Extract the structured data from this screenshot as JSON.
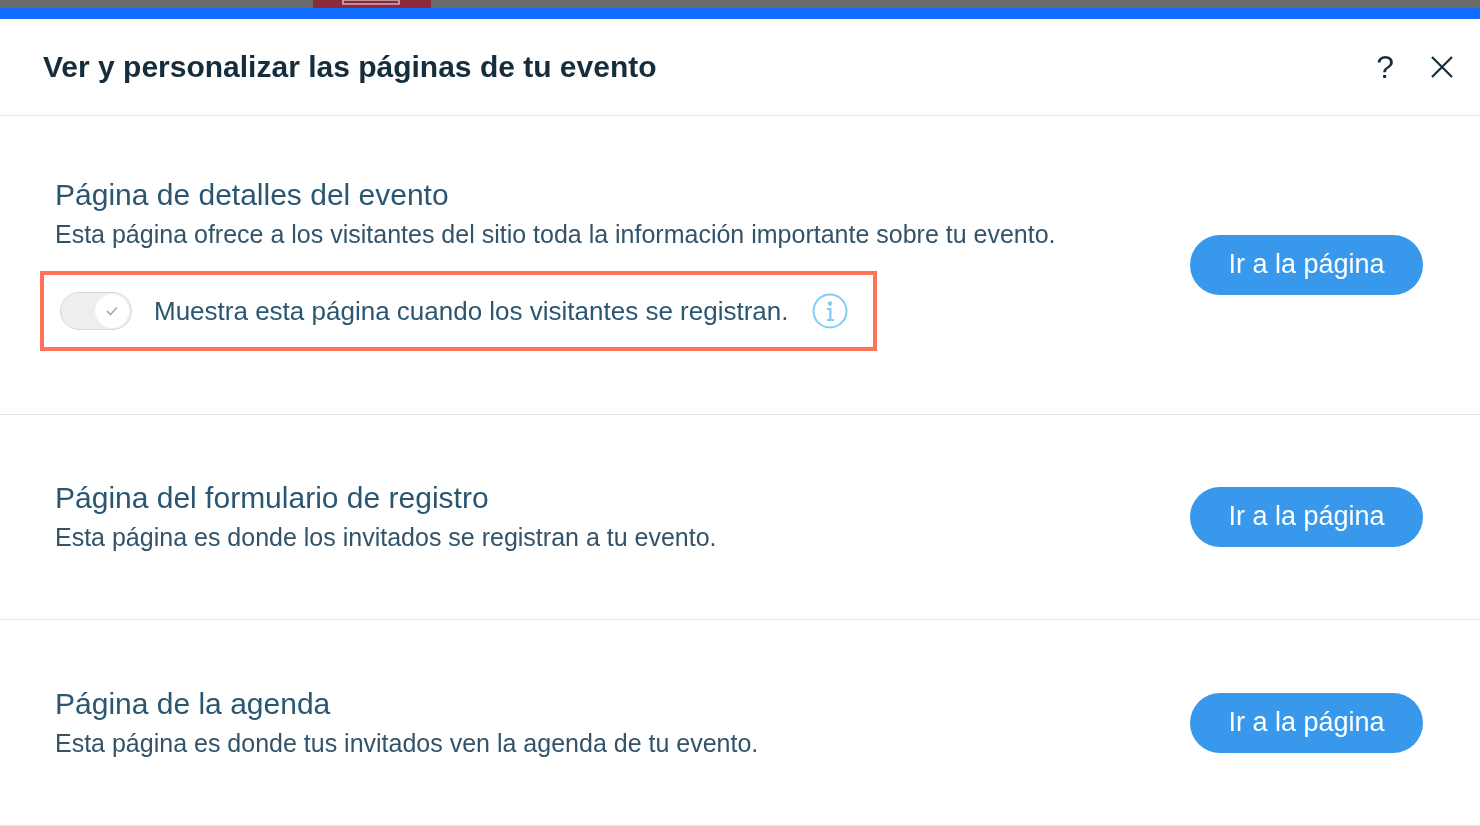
{
  "dialog": {
    "title": "Ver y personalizar las páginas de tu evento",
    "help_label": "?"
  },
  "sections": [
    {
      "heading": "Página de detalles del evento",
      "description": "Esta página ofrece a los visitantes del sitio toda la información importante sobre tu evento.",
      "button": "Ir a la página",
      "option": {
        "label": "Muestra esta página cuando los visitantes se registran.",
        "on": true,
        "disabled": true,
        "highlighted": true
      }
    },
    {
      "heading": "Página del formulario de registro",
      "description": "Esta página es donde los invitados se registran a tu evento.",
      "button": "Ir a la página"
    },
    {
      "heading": "Página de la agenda",
      "description": "Esta página es donde tus invitados ven la agenda de tu evento.",
      "button": "Ir a la página"
    }
  ]
}
